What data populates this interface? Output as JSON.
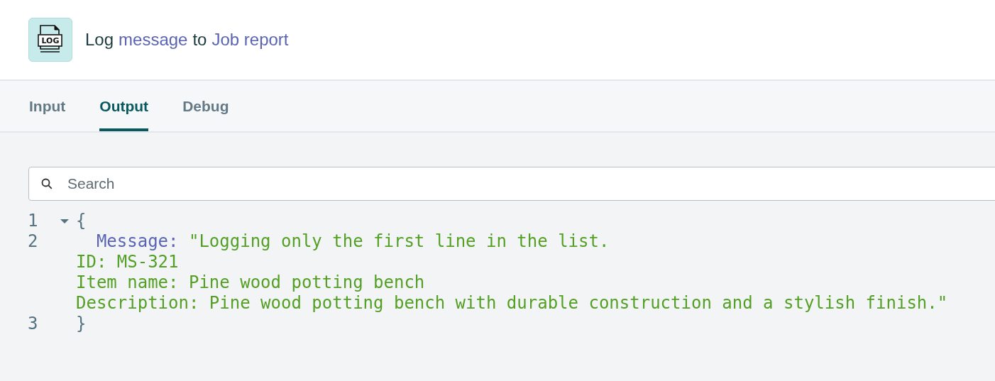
{
  "header": {
    "icon_text": "LOG",
    "title": [
      {
        "text": "Log",
        "kind": "plain"
      },
      {
        "text": "message",
        "kind": "link"
      },
      {
        "text": "to",
        "kind": "plain"
      },
      {
        "text": "Job report",
        "kind": "link"
      }
    ]
  },
  "tabs": [
    {
      "label": "Input",
      "selected": false
    },
    {
      "label": "Output",
      "selected": true
    },
    {
      "label": "Debug",
      "selected": false
    }
  ],
  "search": {
    "placeholder": "Search"
  },
  "code_lines": [
    {
      "kind": "fold",
      "number": "1",
      "expanded": true,
      "tokens": [
        {
          "text": "{",
          "kind": "punct"
        }
      ]
    },
    {
      "kind": "plain",
      "number": "2",
      "tokens": [
        {
          "text": "Message:",
          "kind": "key"
        },
        {
          "text": "\"Logging only the first line in the list.",
          "kind": "string"
        }
      ]
    },
    {
      "kind": "wrap",
      "tokens": [
        {
          "text": "ID: MS-321",
          "kind": "string"
        }
      ]
    },
    {
      "kind": "wrap",
      "tokens": [
        {
          "text": "Item name: Pine wood potting bench",
          "kind": "string"
        }
      ]
    },
    {
      "kind": "wrap",
      "tokens": [
        {
          "text": "Description: Pine wood potting bench with durable construction and a stylish finish.\"",
          "kind": "string"
        }
      ]
    },
    {
      "kind": "plain",
      "number": "3",
      "tokens": [
        {
          "text": "}",
          "kind": "punct"
        }
      ]
    }
  ]
}
